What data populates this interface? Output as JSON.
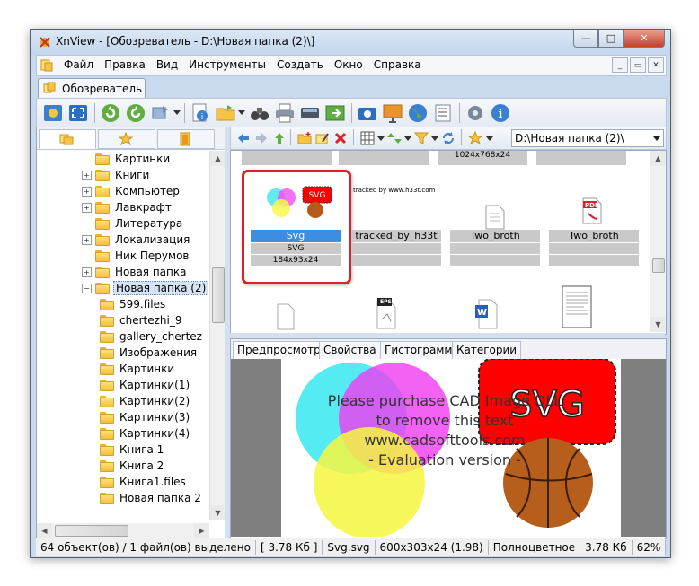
{
  "window": {
    "title": "XnView - [Обозреватель - D:\\Новая папка (2)\\]",
    "controls": {
      "minimize": "—",
      "maximize": "□",
      "close": "✕"
    }
  },
  "menu": {
    "items": [
      "Файл",
      "Правка",
      "Вид",
      "Инструменты",
      "Создать",
      "Окно",
      "Справка"
    ],
    "mdi": {
      "minimize": "_",
      "restore": "▭",
      "close": "✕"
    }
  },
  "doc_tab": {
    "label": "Обозреватель"
  },
  "toolbar_icons": [
    "browser-icon",
    "fullscreen-icon",
    "rotate-left-icon",
    "rotate-right-icon",
    "move-icon",
    "info-icon",
    "open-folder-icon",
    "binoculars-icon",
    "print-icon",
    "scanner-icon",
    "export-icon",
    "capture-icon",
    "slideshow-icon",
    "web-icon",
    "filter-icon",
    "settings-icon",
    "about-icon"
  ],
  "tree": {
    "items": [
      {
        "label": "Картинки",
        "level": 0,
        "expander": "",
        "selected": false
      },
      {
        "label": "Книги",
        "level": 0,
        "expander": "+",
        "selected": false
      },
      {
        "label": "Компьютер",
        "level": 0,
        "expander": "+",
        "selected": false
      },
      {
        "label": "Лавкрафт",
        "level": 0,
        "expander": "+",
        "selected": false
      },
      {
        "label": "Литература",
        "level": 0,
        "expander": "",
        "selected": false
      },
      {
        "label": "Локализация",
        "level": 0,
        "expander": "+",
        "selected": false
      },
      {
        "label": "Ник Перумов",
        "level": 0,
        "expander": "",
        "selected": false
      },
      {
        "label": "Новая папка",
        "level": 0,
        "expander": "+",
        "selected": false
      },
      {
        "label": "Новая папка (2)",
        "level": 0,
        "expander": "−",
        "selected": true
      },
      {
        "label": "599.files",
        "level": 1,
        "expander": "",
        "selected": false
      },
      {
        "label": "chertezhi_9",
        "level": 1,
        "expander": "",
        "selected": false
      },
      {
        "label": "gallery_chertez",
        "level": 1,
        "expander": "",
        "selected": false
      },
      {
        "label": "Изображения",
        "level": 1,
        "expander": "",
        "selected": false
      },
      {
        "label": "Картинки",
        "level": 1,
        "expander": "",
        "selected": false
      },
      {
        "label": "Картинки(1)",
        "level": 1,
        "expander": "",
        "selected": false
      },
      {
        "label": "Картинки(2)",
        "level": 1,
        "expander": "",
        "selected": false
      },
      {
        "label": "Картинки(3)",
        "level": 1,
        "expander": "",
        "selected": false
      },
      {
        "label": "Картинки(4)",
        "level": 1,
        "expander": "",
        "selected": false
      },
      {
        "label": "Книга 1",
        "level": 1,
        "expander": "",
        "selected": false
      },
      {
        "label": "Книга 2",
        "level": 1,
        "expander": "",
        "selected": false
      },
      {
        "label": "Книга1.files",
        "level": 1,
        "expander": "",
        "selected": false
      },
      {
        "label": "Новая папка 2",
        "level": 1,
        "expander": "",
        "selected": false
      }
    ]
  },
  "path": {
    "value": "D:\\Новая папка (2)\\"
  },
  "thumbnails": {
    "top_row_info": "1024x768x24",
    "items": [
      {
        "name": "Svg",
        "type": "SVG",
        "info": "184x93x24",
        "selected": true
      },
      {
        "name": "tracked_by_h33t",
        "type": "",
        "info": "",
        "selected": false,
        "overlay_text": "tracked by www.h33t.com"
      },
      {
        "name": "Two_broth",
        "type": "",
        "info": "",
        "selected": false
      },
      {
        "name": "Two_broth",
        "type": "",
        "info": "",
        "selected": false
      }
    ],
    "pdf_badge": "PDF",
    "eps_badge": "EPS",
    "doc_badge": "W"
  },
  "preview_tabs": [
    "Предпросмотр",
    "Свойства",
    "Гистограмма",
    "Категории"
  ],
  "preview": {
    "watermark": [
      "Please purchase CAD Image DLL",
      "to remove this text",
      "www.cadsofttools.com",
      "- Evaluation version -"
    ],
    "svg_label": "SVG"
  },
  "status": {
    "segments": [
      "64 объект(ов) / 1 файл(ов) выделено",
      "[ 3.78 Кб ]",
      "Svg.svg",
      "600x303x24 (1.98)",
      "Полноцветное",
      "3.78 Кб",
      "62%"
    ]
  }
}
